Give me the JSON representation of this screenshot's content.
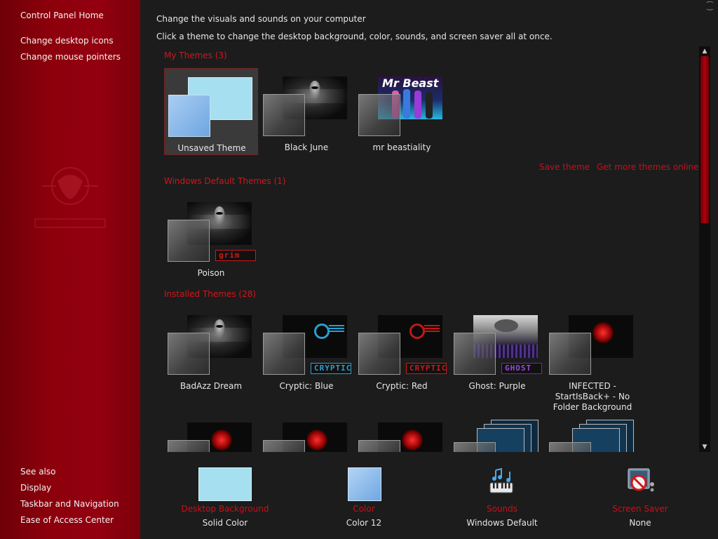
{
  "sidebar": {
    "home": "Control Panel Home",
    "links": [
      "Change desktop icons",
      "Change mouse pointers"
    ],
    "see_also_label": "See also",
    "see_also": [
      "Display",
      "Taskbar and Navigation",
      "Ease of Access Center"
    ]
  },
  "header": {
    "title": "Change the visuals and sounds on your computer",
    "subtitle": "Click a theme to change the desktop background, color, sounds, and screen saver all at once."
  },
  "sections": {
    "my_themes": "My Themes (3)",
    "windows_default": "Windows Default Themes (1)",
    "installed": "Installed Themes (28)"
  },
  "actions": {
    "save_theme": "Save theme",
    "get_more": "Get more themes online"
  },
  "my_themes": [
    {
      "label": "Unsaved Theme",
      "selected": true
    },
    {
      "label": "Black June"
    },
    {
      "label": "mr beastiality",
      "art_text": "Mr Beast"
    }
  ],
  "default_themes": [
    {
      "label": "Poison",
      "badge": "grim"
    }
  ],
  "installed_themes": [
    {
      "label": "BadAzz Dream"
    },
    {
      "label": "Cryptic: Blue",
      "badge": "CRYPTIC",
      "color": "#2a9fd0"
    },
    {
      "label": "Cryptic: Red",
      "badge": "CRYPTIC",
      "color": "#d01818"
    },
    {
      "label": "Ghost: Purple",
      "badge": "GHOST",
      "color": "#8a3ad8"
    },
    {
      "label": "INFECTED - StartIsBack+ - No Folder Background"
    }
  ],
  "bottom": {
    "desktop_background": {
      "title": "Desktop Background",
      "value": "Solid Color"
    },
    "color": {
      "title": "Color",
      "value": "Color 12"
    },
    "sounds": {
      "title": "Sounds",
      "value": "Windows Default"
    },
    "screen_saver": {
      "title": "Screen Saver",
      "value": "None"
    }
  },
  "colors": {
    "accent_red": "#c8101a",
    "sidebar_red": "#8c000b",
    "desktop_bg_swatch": "#a6dfef",
    "window_color_swatch": "#7fb2e6"
  }
}
